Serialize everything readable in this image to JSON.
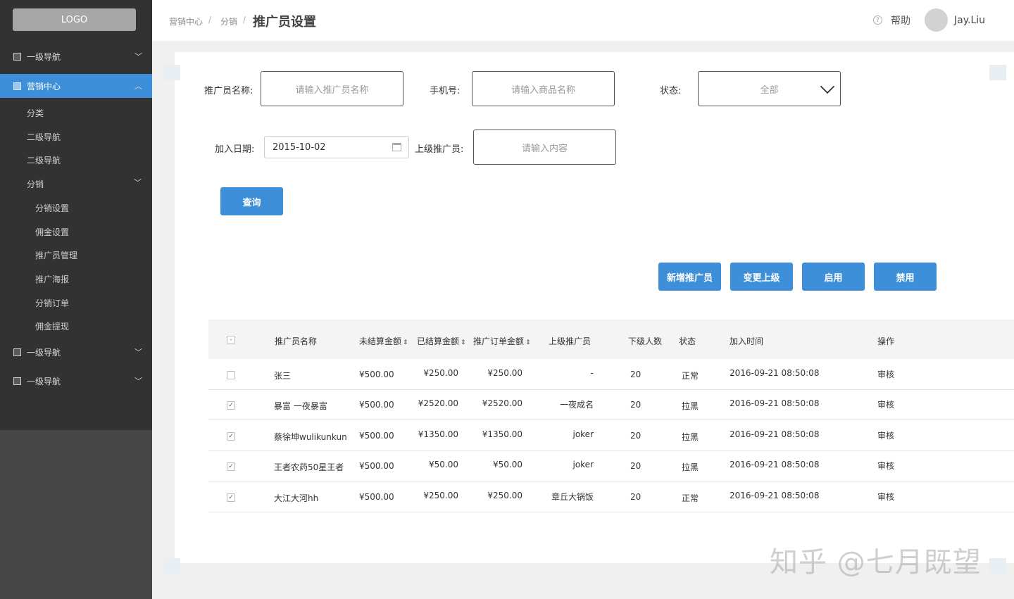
{
  "sidebar": {
    "logo": "LOGO",
    "items": [
      {
        "label": "一级导航"
      },
      {
        "label": "营销中心"
      },
      {
        "label": "一级导航"
      },
      {
        "label": "一级导航"
      }
    ],
    "sub": [
      "分类",
      "二级导航",
      "二级导航",
      "分销"
    ],
    "sub3": [
      "分销设置",
      "佣金设置",
      "推广员管理",
      "推广海报",
      "分销订单",
      "佣金提现"
    ]
  },
  "header": {
    "crumbs": [
      "营销中心",
      "分销"
    ],
    "title": "推广员设置",
    "help": "帮助",
    "user": "Jay.Liu"
  },
  "form": {
    "name_label": "推广员名称:",
    "name_placeholder": "请输入推广员名称",
    "phone_label": "手机号:",
    "phone_placeholder": "请输入商品名称",
    "status_label": "状态:",
    "status_value": "全部",
    "date_label": "加入日期:",
    "date_value": "2015-10-02",
    "parent_label": "上级推广员:",
    "parent_placeholder": "请输入内容",
    "query": "查询"
  },
  "actions": [
    "新增推广员",
    "变更上级",
    "启用",
    "禁用"
  ],
  "table": {
    "select_all": "-",
    "headers": [
      "推广员名称",
      "未结算金额",
      "已结算金额",
      "推广订单金额",
      "上级推广员",
      "下级人数",
      "状态",
      "加入时间",
      "操作"
    ],
    "rows": [
      {
        "checked": "",
        "name": "张三",
        "unsettled": "¥500.00",
        "settled": "¥250.00",
        "order": "¥250.00",
        "parent": "-",
        "count": "20",
        "status": "正常",
        "time": "2016-09-21  08:50:08",
        "op": "审核"
      },
      {
        "checked": "✓",
        "name": "暴富 一夜暴富",
        "unsettled": "¥500.00",
        "settled": "¥2520.00",
        "order": "¥2520.00",
        "parent": "一夜成名",
        "count": "20",
        "status": "拉黑",
        "time": "2016-09-21  08:50:08",
        "op": "审核"
      },
      {
        "checked": "✓",
        "name": "蔡徐坤wulikunkun",
        "unsettled": "¥500.00",
        "settled": "¥1350.00",
        "order": "¥1350.00",
        "parent": "joker",
        "count": "20",
        "status": "拉黑",
        "time": "2016-09-21  08:50:08",
        "op": "审核"
      },
      {
        "checked": "✓",
        "name": "王者农药50星王者",
        "unsettled": "¥500.00",
        "settled": "¥50.00",
        "order": "¥50.00",
        "parent": "joker",
        "count": "20",
        "status": "拉黑",
        "time": "2016-09-21  08:50:08",
        "op": "审核"
      },
      {
        "checked": "✓",
        "name": "大江大河hh",
        "unsettled": "¥500.00",
        "settled": "¥250.00",
        "order": "¥250.00",
        "parent": "章丘大锅饭",
        "count": "20",
        "status": "正常",
        "time": "2016-09-21  08:50:08",
        "op": "审核"
      }
    ]
  },
  "watermark": "知乎 @七月既望"
}
